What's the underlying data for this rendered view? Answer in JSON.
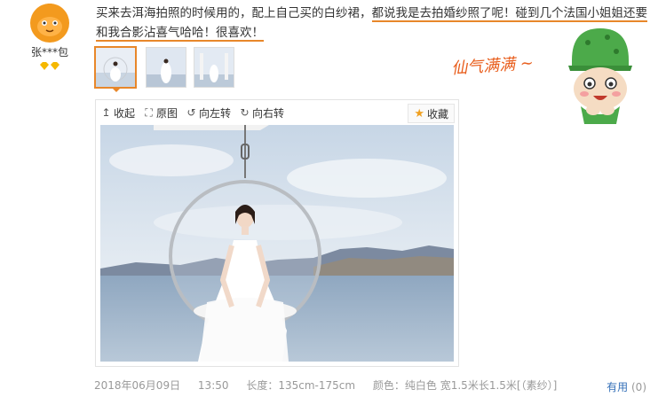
{
  "user": {
    "name": "张***包",
    "avatar_color": "#f39a1e",
    "level_color": "#f5b800"
  },
  "review": {
    "text_part1": "买来去洱海拍照的时候用的，配上自己买的白纱裙，",
    "text_part2": "都说我是去拍婚纱照了呢！碰到几个法国小姐姐还要和我合影沾喜气哈哈！很喜欢！"
  },
  "thumbnails": [
    {
      "label": "图片1",
      "active": true
    },
    {
      "label": "图片2",
      "active": false
    },
    {
      "label": "图片3",
      "active": false
    }
  ],
  "viewer": {
    "collapse_label": "收起",
    "original_label": "原图",
    "rotate_left_label": "向左转",
    "rotate_right_label": "向右转",
    "favorite_label": "收藏"
  },
  "sticker": {
    "text": "仙气满满 ~"
  },
  "footer": {
    "date": "2018年06月09日",
    "time": "13:50",
    "length_label": "长度：",
    "length_value": "135cm-175cm",
    "color_label": "颜色：",
    "color_value": "纯白色 宽1.5米长1.5米[（素纱）]",
    "useful_label": "有用",
    "useful_count": "(0)"
  },
  "colors": {
    "accent": "#e8872a",
    "link": "#3570b8",
    "sticker_green": "#4caa4a"
  }
}
